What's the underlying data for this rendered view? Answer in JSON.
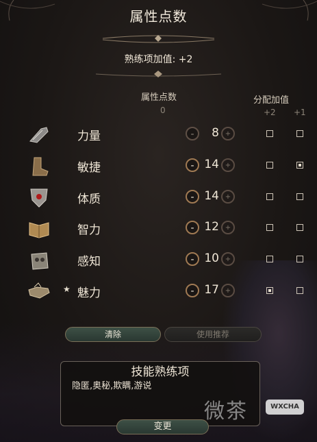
{
  "panel": {
    "title": "属性点数",
    "proficiency_bonus": "熟练项加值: +2"
  },
  "columns": {
    "points_header": "属性点数",
    "points_remaining": "0",
    "assign_header": "分配加值",
    "bonus_plus2": "+2",
    "bonus_plus1": "+1"
  },
  "abilities": [
    {
      "name": "力量",
      "value": "8",
      "icon": "strength-gauntlet-icon",
      "primary": false,
      "plus2": false,
      "plus1": false,
      "minus_enabled": false
    },
    {
      "name": "敏捷",
      "value": "14",
      "icon": "dexterity-boot-icon",
      "primary": false,
      "plus2": false,
      "plus1": true,
      "minus_enabled": true
    },
    {
      "name": "体质",
      "value": "14",
      "icon": "constitution-heart-icon",
      "primary": false,
      "plus2": false,
      "plus1": false,
      "minus_enabled": true
    },
    {
      "name": "智力",
      "value": "12",
      "icon": "intelligence-book-icon",
      "primary": false,
      "plus2": false,
      "plus1": false,
      "minus_enabled": true
    },
    {
      "name": "感知",
      "value": "10",
      "icon": "wisdom-owl-icon",
      "primary": false,
      "plus2": false,
      "plus1": false,
      "minus_enabled": true
    },
    {
      "name": "魅力",
      "value": "17",
      "icon": "charisma-hand-icon",
      "primary": true,
      "plus2": true,
      "plus1": false,
      "minus_enabled": true
    }
  ],
  "buttons": {
    "clear": "清除",
    "use_recommended": "使用推荐",
    "change": "变更",
    "minus": "-",
    "plus": "+",
    "primary_star": "★"
  },
  "skills": {
    "title": "技能熟练项",
    "list": "隐匿,奥秘,欺瞒,游说"
  },
  "watermark": {
    "text": "微茶",
    "badge": "WXCHA"
  },
  "colors": {
    "accent_bronze": "#a07a53",
    "button_green": "#3e5046",
    "text_cream": "#efe6d6"
  }
}
